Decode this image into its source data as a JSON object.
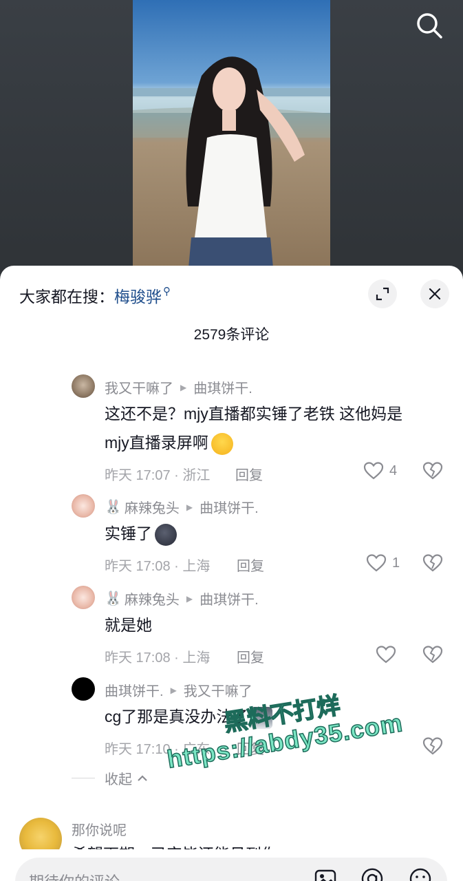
{
  "hot_search": {
    "prefix": "大家都在搜：",
    "keyword": "梅骏骅"
  },
  "comment_count": "2579条评论",
  "comments": [
    {
      "author": "我又干嘛了",
      "reply_to": "曲琪饼干.",
      "text_line1": "这还不是？mjy直播都实锤了老铁 这他妈是",
      "text_line2": "mjy直播录屏啊",
      "time_loc": "昨天 17:07 · 浙江",
      "reply_label": "回复",
      "likes": "4"
    },
    {
      "author": "麻辣兔头",
      "reply_to": "曲琪饼干.",
      "text": "实锤了",
      "time_loc": "昨天 17:08 · 上海",
      "reply_label": "回复",
      "likes": "1"
    },
    {
      "author": "麻辣兔头",
      "reply_to": "曲琪饼干.",
      "text": "就是她",
      "time_loc": "昨天 17:08 · 上海",
      "reply_label": "回复",
      "likes": ""
    },
    {
      "author": "曲琪饼干.",
      "reply_to": "我又干嘛了",
      "text": "cg了那是真没办法了",
      "time_loc": "昨天 17:10 · 广东",
      "reply_label": "回复",
      "likes": ""
    }
  ],
  "collapse_label": "收起",
  "next_comment": {
    "author": "那你说呢",
    "text": "希望下期，已完毕还能见到你"
  },
  "input": {
    "placeholder": "期待你的评论"
  },
  "watermark": {
    "line1": "黑料不打烊",
    "line2": "https://abdy35.com"
  },
  "icons": [
    "search-icon",
    "expand-icon",
    "close-icon",
    "heart-icon",
    "broken-heart-icon",
    "image-icon",
    "at-icon",
    "emoji-icon"
  ]
}
